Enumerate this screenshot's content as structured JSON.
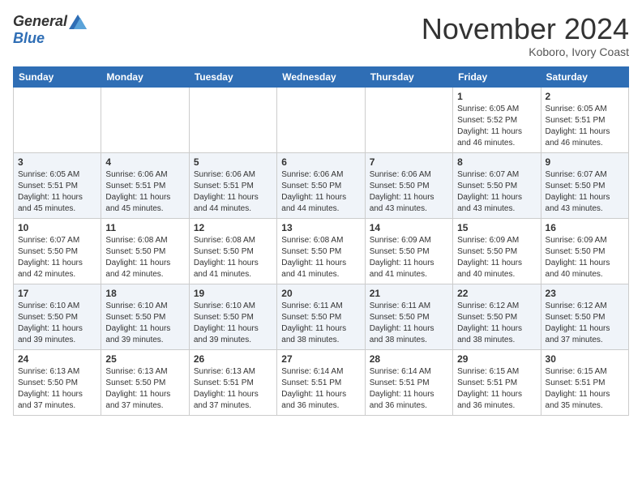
{
  "header": {
    "logo_general": "General",
    "logo_blue": "Blue",
    "month_title": "November 2024",
    "location": "Koboro, Ivory Coast"
  },
  "weekdays": [
    "Sunday",
    "Monday",
    "Tuesday",
    "Wednesday",
    "Thursday",
    "Friday",
    "Saturday"
  ],
  "weeks": [
    [
      {
        "day": "",
        "info": ""
      },
      {
        "day": "",
        "info": ""
      },
      {
        "day": "",
        "info": ""
      },
      {
        "day": "",
        "info": ""
      },
      {
        "day": "",
        "info": ""
      },
      {
        "day": "1",
        "info": "Sunrise: 6:05 AM\nSunset: 5:52 PM\nDaylight: 11 hours and 46 minutes."
      },
      {
        "day": "2",
        "info": "Sunrise: 6:05 AM\nSunset: 5:51 PM\nDaylight: 11 hours and 46 minutes."
      }
    ],
    [
      {
        "day": "3",
        "info": "Sunrise: 6:05 AM\nSunset: 5:51 PM\nDaylight: 11 hours and 45 minutes."
      },
      {
        "day": "4",
        "info": "Sunrise: 6:06 AM\nSunset: 5:51 PM\nDaylight: 11 hours and 45 minutes."
      },
      {
        "day": "5",
        "info": "Sunrise: 6:06 AM\nSunset: 5:51 PM\nDaylight: 11 hours and 44 minutes."
      },
      {
        "day": "6",
        "info": "Sunrise: 6:06 AM\nSunset: 5:50 PM\nDaylight: 11 hours and 44 minutes."
      },
      {
        "day": "7",
        "info": "Sunrise: 6:06 AM\nSunset: 5:50 PM\nDaylight: 11 hours and 43 minutes."
      },
      {
        "day": "8",
        "info": "Sunrise: 6:07 AM\nSunset: 5:50 PM\nDaylight: 11 hours and 43 minutes."
      },
      {
        "day": "9",
        "info": "Sunrise: 6:07 AM\nSunset: 5:50 PM\nDaylight: 11 hours and 43 minutes."
      }
    ],
    [
      {
        "day": "10",
        "info": "Sunrise: 6:07 AM\nSunset: 5:50 PM\nDaylight: 11 hours and 42 minutes."
      },
      {
        "day": "11",
        "info": "Sunrise: 6:08 AM\nSunset: 5:50 PM\nDaylight: 11 hours and 42 minutes."
      },
      {
        "day": "12",
        "info": "Sunrise: 6:08 AM\nSunset: 5:50 PM\nDaylight: 11 hours and 41 minutes."
      },
      {
        "day": "13",
        "info": "Sunrise: 6:08 AM\nSunset: 5:50 PM\nDaylight: 11 hours and 41 minutes."
      },
      {
        "day": "14",
        "info": "Sunrise: 6:09 AM\nSunset: 5:50 PM\nDaylight: 11 hours and 41 minutes."
      },
      {
        "day": "15",
        "info": "Sunrise: 6:09 AM\nSunset: 5:50 PM\nDaylight: 11 hours and 40 minutes."
      },
      {
        "day": "16",
        "info": "Sunrise: 6:09 AM\nSunset: 5:50 PM\nDaylight: 11 hours and 40 minutes."
      }
    ],
    [
      {
        "day": "17",
        "info": "Sunrise: 6:10 AM\nSunset: 5:50 PM\nDaylight: 11 hours and 39 minutes."
      },
      {
        "day": "18",
        "info": "Sunrise: 6:10 AM\nSunset: 5:50 PM\nDaylight: 11 hours and 39 minutes."
      },
      {
        "day": "19",
        "info": "Sunrise: 6:10 AM\nSunset: 5:50 PM\nDaylight: 11 hours and 39 minutes."
      },
      {
        "day": "20",
        "info": "Sunrise: 6:11 AM\nSunset: 5:50 PM\nDaylight: 11 hours and 38 minutes."
      },
      {
        "day": "21",
        "info": "Sunrise: 6:11 AM\nSunset: 5:50 PM\nDaylight: 11 hours and 38 minutes."
      },
      {
        "day": "22",
        "info": "Sunrise: 6:12 AM\nSunset: 5:50 PM\nDaylight: 11 hours and 38 minutes."
      },
      {
        "day": "23",
        "info": "Sunrise: 6:12 AM\nSunset: 5:50 PM\nDaylight: 11 hours and 37 minutes."
      }
    ],
    [
      {
        "day": "24",
        "info": "Sunrise: 6:13 AM\nSunset: 5:50 PM\nDaylight: 11 hours and 37 minutes."
      },
      {
        "day": "25",
        "info": "Sunrise: 6:13 AM\nSunset: 5:50 PM\nDaylight: 11 hours and 37 minutes."
      },
      {
        "day": "26",
        "info": "Sunrise: 6:13 AM\nSunset: 5:51 PM\nDaylight: 11 hours and 37 minutes."
      },
      {
        "day": "27",
        "info": "Sunrise: 6:14 AM\nSunset: 5:51 PM\nDaylight: 11 hours and 36 minutes."
      },
      {
        "day": "28",
        "info": "Sunrise: 6:14 AM\nSunset: 5:51 PM\nDaylight: 11 hours and 36 minutes."
      },
      {
        "day": "29",
        "info": "Sunrise: 6:15 AM\nSunset: 5:51 PM\nDaylight: 11 hours and 36 minutes."
      },
      {
        "day": "30",
        "info": "Sunrise: 6:15 AM\nSunset: 5:51 PM\nDaylight: 11 hours and 35 minutes."
      }
    ]
  ]
}
